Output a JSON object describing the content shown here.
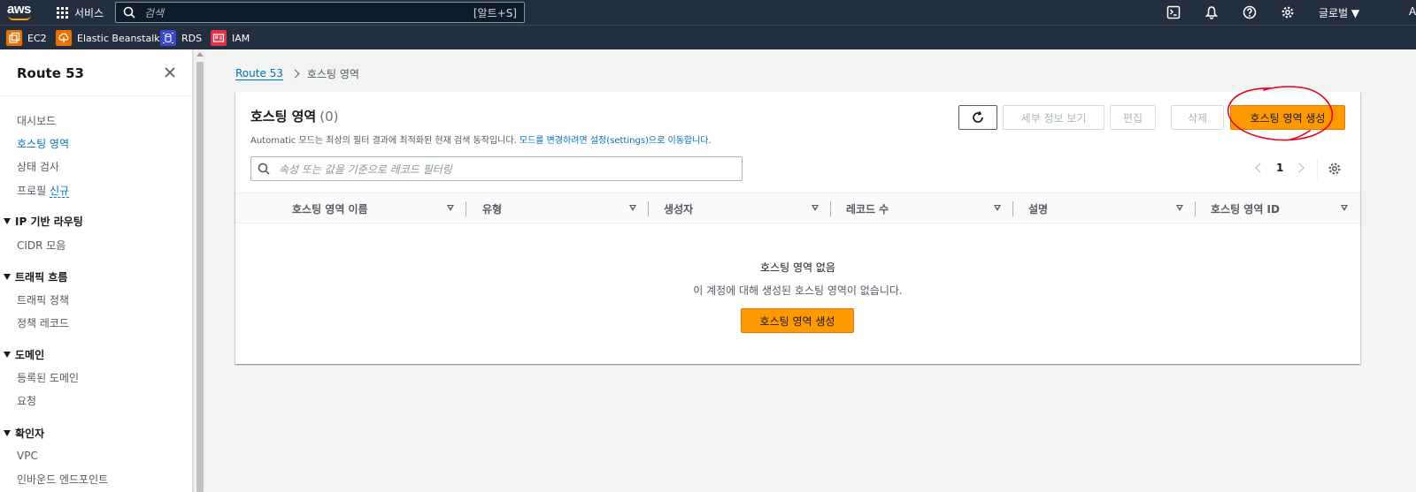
{
  "topnav": {
    "logo_text": "aws",
    "services_label": "서비스",
    "search_placeholder": "검색",
    "search_shortcut": "[알트+S]",
    "region_label": "글로벌 ▼",
    "account_label": "A",
    "icons": [
      "cloudshell-icon",
      "notifications-bell-icon",
      "help-icon",
      "settings-gear-icon"
    ]
  },
  "favorites": [
    {
      "label": "EC2",
      "color": "#ed7100"
    },
    {
      "label": "Elastic Beanstalk",
      "color": "#ed7100"
    },
    {
      "label": "RDS",
      "color": "#3b48cc"
    },
    {
      "label": "IAM",
      "color": "#dd344c"
    }
  ],
  "sidebar": {
    "title": "Route 53",
    "items": [
      {
        "label": "대시보드"
      },
      {
        "label": "호스팅 영역",
        "active": true
      },
      {
        "label": "상태 검사"
      },
      {
        "label": "프로필",
        "badge": "신규"
      }
    ],
    "groups": [
      {
        "label": "IP 기반 라우팅",
        "items": [
          "CIDR 모음"
        ]
      },
      {
        "label": "트래픽 흐름",
        "items": [
          "트래픽 정책",
          "정책 레코드"
        ]
      },
      {
        "label": "도메인",
        "items": [
          "등록된 도메인",
          "요청"
        ]
      },
      {
        "label": "확인자",
        "items": [
          "VPC",
          "인바운드 엔드포인트"
        ]
      }
    ]
  },
  "breadcrumb": {
    "root": "Route 53",
    "current": "호스팅 영역"
  },
  "panel": {
    "title": "호스팅 영역",
    "count": "(0)",
    "description": "Automatic 모드는 최상의 필터 결과에 최적화된 현재 검색 동작입니다.",
    "description_link": "모드를 변경하려면 설정(settings)으로 이동합니다.",
    "buttons": {
      "details": "세부 정보 보기",
      "edit": "편집",
      "delete": "삭제",
      "create": "호스팅 영역 생성"
    },
    "filter_placeholder": "속성 또는 값을 기준으로 레코드 필터링",
    "page": "1",
    "columns": [
      "호스팅 영역 이름",
      "유형",
      "생성자",
      "레코드 수",
      "설명",
      "호스팅 영역 ID"
    ],
    "empty_title": "호스팅 영역 없음",
    "empty_desc": "이 계정에 대해 생성된 호스팅 영역이 없습니다.",
    "empty_button": "호스팅 영역 생성"
  },
  "colors": {
    "accent": "#ff9900",
    "link": "#0073bb",
    "nav_bg": "#232f3e",
    "annotation": "#e8001c"
  }
}
